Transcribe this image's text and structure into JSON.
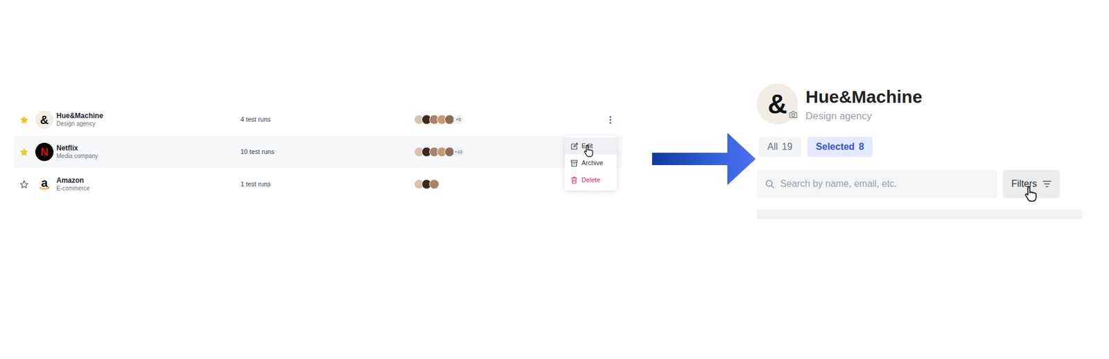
{
  "clients": [
    {
      "logo": "&",
      "kind": "monogram",
      "name": "Hue&Machine",
      "subtitle": "Design agency",
      "runs": "4 test runs",
      "starred": true,
      "avatars": 5,
      "more": "+5",
      "highlighted": false,
      "menu_open": true
    },
    {
      "logo": "N",
      "kind": "netflix",
      "name": "Netflix",
      "subtitle": "Media company",
      "runs": "10 test runs",
      "starred": true,
      "avatars": 5,
      "more": "+10",
      "highlighted": true,
      "menu_open": false
    },
    {
      "logo": "a",
      "kind": "amazon",
      "name": "Amazon",
      "subtitle": "E-commerce",
      "runs": "1 test runs",
      "starred": false,
      "avatars": 3,
      "highlighted": false,
      "menu_open": false
    }
  ],
  "menu": [
    {
      "label": "Edit",
      "kind": "edit",
      "hovered": true
    },
    {
      "label": "Archive",
      "kind": "archive",
      "hovered": false
    },
    {
      "label": "Delete",
      "kind": "delete",
      "hovered": false
    }
  ],
  "profile": {
    "logo": "&",
    "title": "Hue&Machine",
    "subtitle": "Design agency",
    "tabs": [
      {
        "label": "All",
        "count": "19",
        "selected": false
      },
      {
        "label": "Selected",
        "count": "8",
        "selected": true
      }
    ],
    "search": {
      "placeholder": "Search by name, email, etc."
    },
    "filters_button": "Filters"
  }
}
